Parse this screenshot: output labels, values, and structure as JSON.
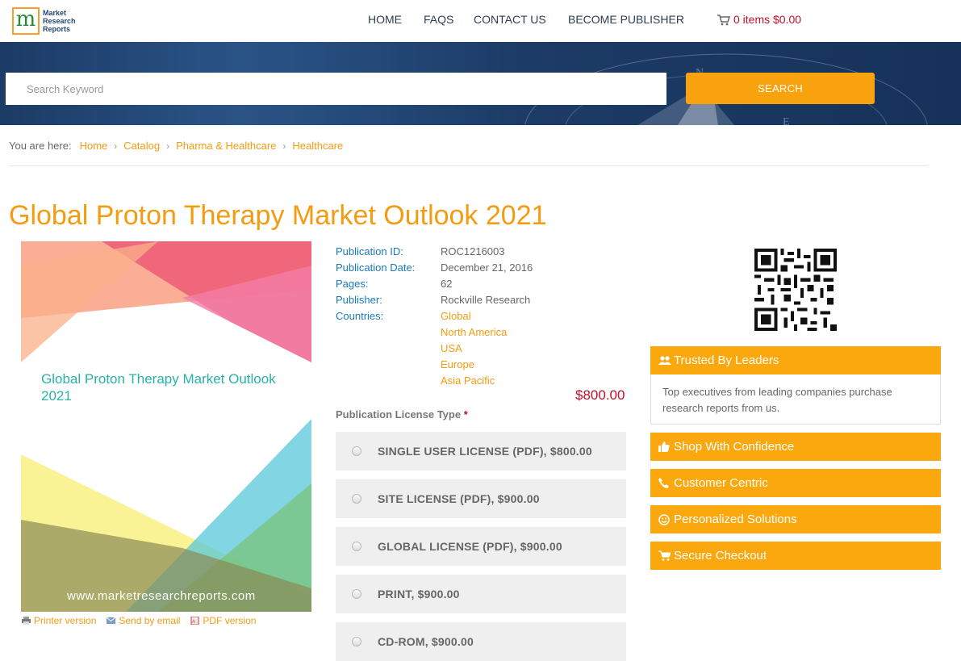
{
  "header": {
    "logo_text": [
      "Market",
      "Research",
      "Reports"
    ],
    "nav": [
      "HOME",
      "FAQS",
      "CONTACT US",
      "BECOME PUBLISHER"
    ],
    "cart": "0 items $0.00"
  },
  "search": {
    "placeholder": "Search Keyword",
    "button": "SEARCH"
  },
  "breadcrumb": {
    "prefix": "You are here:",
    "items": [
      "Home",
      "Catalog",
      "Pharma & Healthcare",
      "Healthcare"
    ]
  },
  "report": {
    "title": "Global Proton Therapy Market Outlook 2021",
    "cover_title": "Global Proton Therapy Market Outlook 2021",
    "cover_url": "www.marketresearchreports.com",
    "meta": {
      "id_label": "Publication ID:",
      "id": "ROC1216003",
      "date_label": "Publication Date:",
      "date": "December 21, 2016",
      "pages_label": "Pages:",
      "pages": "62",
      "publisher_label": "Publisher:",
      "publisher": "Rockville Research",
      "countries_label": "Countries:",
      "countries": [
        "Global",
        "North America",
        "USA",
        "Europe",
        "Asia Pacific"
      ]
    },
    "price": "$800.00",
    "license_label": "Publication License Type",
    "required_mark": "*",
    "licenses": [
      "SINGLE USER LICENSE (PDF), $800.00",
      "SITE LICENSE (PDF), $900.00",
      "GLOBAL LICENSE (PDF), $900.00",
      "PRINT, $900.00",
      "CD-ROM, $900.00"
    ]
  },
  "share": {
    "printer": "Printer version",
    "email": "Send by email",
    "pdf": "PDF version"
  },
  "sidebar": {
    "trusted_title": "Trusted By Leaders",
    "trusted_body": "Top executives from leading companies purchase research reports from us.",
    "items": [
      "Shop With Confidence",
      "Customer Centric",
      "Personalized Solutions",
      "Secure Checkout"
    ]
  },
  "colors": {
    "accent": "#f39c12",
    "side_box": "#fba80e",
    "price": "#c0102b",
    "label_blue": "#1a7ab8",
    "banner": "#1c3b66"
  }
}
